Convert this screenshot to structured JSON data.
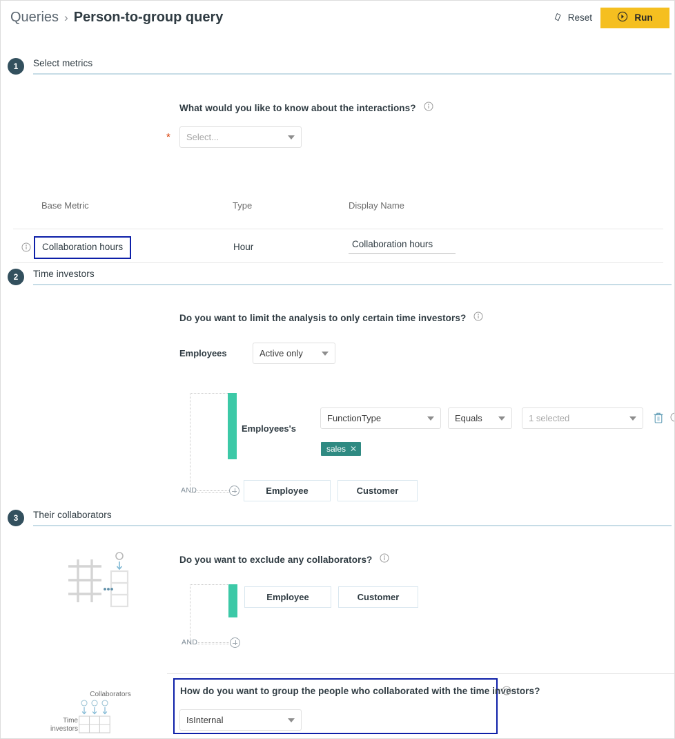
{
  "header": {
    "breadcrumb_root": "Queries",
    "breadcrumb_separator": "›",
    "breadcrumb_current": "Person-to-group query",
    "reset_label": "Reset",
    "reset_icon": "eraser-icon",
    "run_label": "Run",
    "run_icon": "play-circle-icon"
  },
  "colors": {
    "accent_yellow": "#f5bf20",
    "step_badge": "#33505e",
    "teal_bar": "#3cc9a7",
    "tag_teal": "#2f8a82",
    "highlight_blue": "#0d1fa8",
    "rule_blue": "#c6dce6",
    "required_red": "#d83b01"
  },
  "steps": [
    {
      "number": "1",
      "title": "Select metrics"
    },
    {
      "number": "2",
      "title": "Time investors"
    },
    {
      "number": "3",
      "title": "Their collaborators"
    }
  ],
  "section_metrics": {
    "question": "What would you like to know about the interactions?",
    "info_icon": "info-icon",
    "required_marker": "*",
    "select_placeholder": "Select...",
    "select_value": "",
    "table": {
      "columns": [
        "Base Metric",
        "Type",
        "Display Name"
      ],
      "rows": [
        {
          "info_icon": "info-icon",
          "base_metric": "Collaboration hours",
          "type": "Hour",
          "display_name": "Collaboration hours"
        }
      ]
    }
  },
  "section_time_investors": {
    "question": "Do you want to limit the analysis to only certain time investors?",
    "info_icon": "info-icon",
    "employees_label": "Employees",
    "employees_value": "Active only",
    "filter_group_label": "Employees's",
    "filter_row": {
      "attribute": "FunctionType",
      "operator": "Equals",
      "values_placeholder": "1 selected",
      "tags": [
        {
          "label": "sales",
          "remove_icon": "close-icon"
        }
      ],
      "delete_icon": "trash-icon",
      "info_icon": "info-icon"
    },
    "and_label": "AND",
    "add_icon": "plus-circle-icon",
    "entity_buttons": [
      "Employee",
      "Customer"
    ]
  },
  "section_collaborators": {
    "question": "Do you want to exclude any collaborators?",
    "info_icon": "info-icon",
    "and_label": "AND",
    "add_icon": "plus-circle-icon",
    "entity_buttons": [
      "Employee",
      "Customer"
    ],
    "diagram_icon": "grid-to-column-icon"
  },
  "section_grouping": {
    "question": "How do you want to group the people who collaborated with the time investors?",
    "info_icon": "info-icon",
    "select_value": "IsInternal",
    "diagram": {
      "icon": "matrix-icon",
      "columns_label": "Collaborators",
      "rows_label_line1": "Time",
      "rows_label_line2": "investors"
    }
  }
}
